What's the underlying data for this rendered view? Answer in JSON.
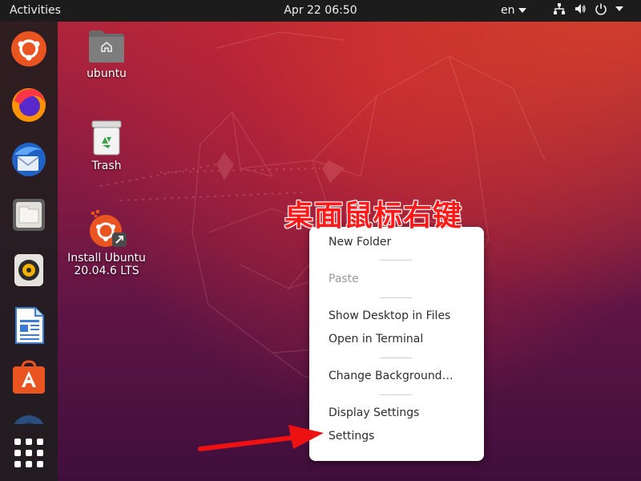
{
  "topbar": {
    "activities": "Activities",
    "clock": "Apr 22  06:50",
    "language": "en",
    "tray_icons": [
      "network-icon",
      "volume-icon",
      "power-icon",
      "chevron-down-icon"
    ]
  },
  "dock": {
    "items": [
      "ubuntu-installer",
      "firefox",
      "thunderbird",
      "files",
      "rhythmbox",
      "libreoffice-writer",
      "ubuntu-software",
      "help"
    ],
    "show_apps": "show-applications"
  },
  "desktop": {
    "icons": [
      {
        "label": "ubuntu",
        "icon": "home-folder-icon"
      },
      {
        "label": "Trash",
        "icon": "trash-icon"
      },
      {
        "label": "Install Ubuntu\n20.04.6 LTS",
        "line1": "Install Ubuntu",
        "line2": "20.04.6 LTS",
        "icon": "install-ubuntu-icon"
      }
    ]
  },
  "annotation": "桌面鼠标右键",
  "context_menu": {
    "items": [
      {
        "label": "New Folder",
        "enabled": true
      },
      {
        "label": "Paste",
        "enabled": false
      },
      {
        "label": "Show Desktop in Files",
        "enabled": true
      },
      {
        "label": "Open in Terminal",
        "enabled": true
      },
      {
        "label": "Change Background…",
        "enabled": true
      },
      {
        "label": "Display Settings",
        "enabled": true
      },
      {
        "label": "Settings",
        "enabled": true
      }
    ]
  },
  "colors": {
    "ubuntu_orange": "#e95420",
    "annotation_red": "#ff1a1a",
    "topbar": "#1c1c1c"
  }
}
